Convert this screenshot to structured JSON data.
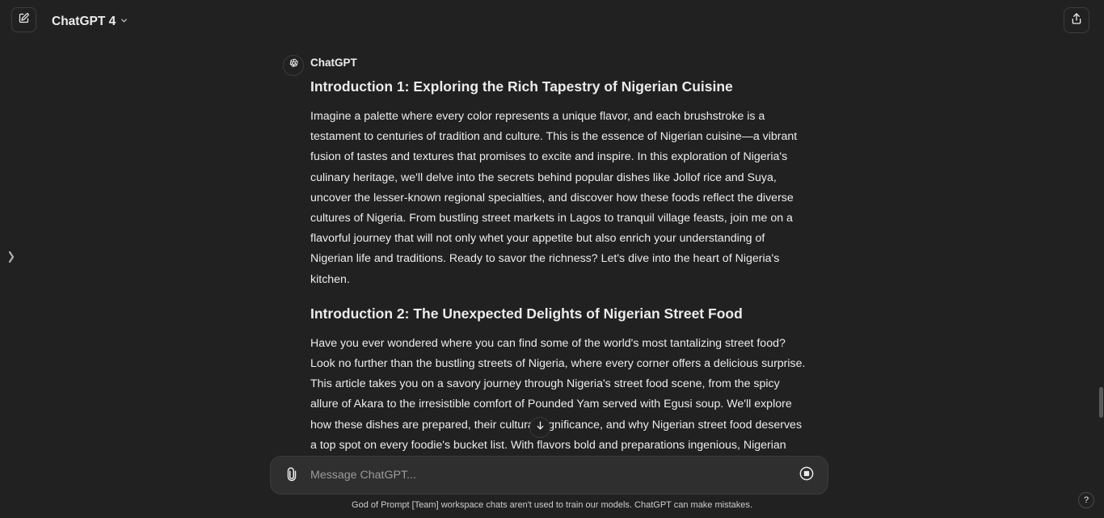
{
  "header": {
    "model_name": "ChatGPT 4",
    "new_chat_icon": "edit-icon",
    "share_icon": "share-icon",
    "model_chevron_icon": "chevron-down-icon"
  },
  "sidebar_toggle_icon": "chevron-right-icon",
  "message": {
    "author": "ChatGPT",
    "avatar_icon": "openai-logo-icon",
    "sections": [
      {
        "heading": "Introduction 1: Exploring the Rich Tapestry of Nigerian Cuisine",
        "lines": [
          "Imagine a palette where every color represents a unique flavor, and each brushstroke is a",
          "testament to centuries of tradition and culture. This is the essence of Nigerian cuisine—a vibrant",
          "fusion of tastes and textures that promises to excite and inspire. In this exploration of Nigeria's",
          "culinary heritage, we'll delve into the secrets behind popular dishes like Jollof rice and Suya,",
          "uncover the lesser-known regional specialties, and discover how these foods reflect the diverse",
          "cultures of Nigeria. From bustling street markets in Lagos to tranquil village feasts, join me on a",
          "flavorful journey that will not only whet your appetite but also enrich your understanding of",
          "Nigerian life and traditions. Ready to savor the richness? Let's dive into the heart of Nigeria's",
          "kitchen."
        ]
      },
      {
        "heading": "Introduction 2: The Unexpected Delights of Nigerian Street Food",
        "lines": [
          "Have you ever wondered where you can find some of the world's most tantalizing street food?",
          "Look no further than the bustling streets of Nigeria, where every corner offers a delicious surprise.",
          "This article takes you on a savory journey through Nigeria's street food scene, from the spicy",
          "allure of Akara to the irresistible comfort of Pounded Yam served with Egusi soup. We'll explore",
          "how these dishes are prepared, their cultural significance, and why Nigerian street food deserves",
          "a top spot on every foodie's bucket list. With flavors bold and preparations ingenious, Nigerian"
        ]
      }
    ]
  },
  "composer": {
    "placeholder": "Message ChatGPT...",
    "value": "",
    "attach_icon": "paperclip-icon",
    "stop_icon": "stop-icon"
  },
  "scroll_down_icon": "arrow-down-icon",
  "footer": {
    "note": "God of Prompt [Team] workspace chats aren't used to train our models. ChatGPT can make mistakes.",
    "help_label": "?"
  },
  "colors": {
    "background": "#212121",
    "composer_bg": "#2f2f2f",
    "text": "#ececec",
    "muted": "#9b9b9b"
  }
}
